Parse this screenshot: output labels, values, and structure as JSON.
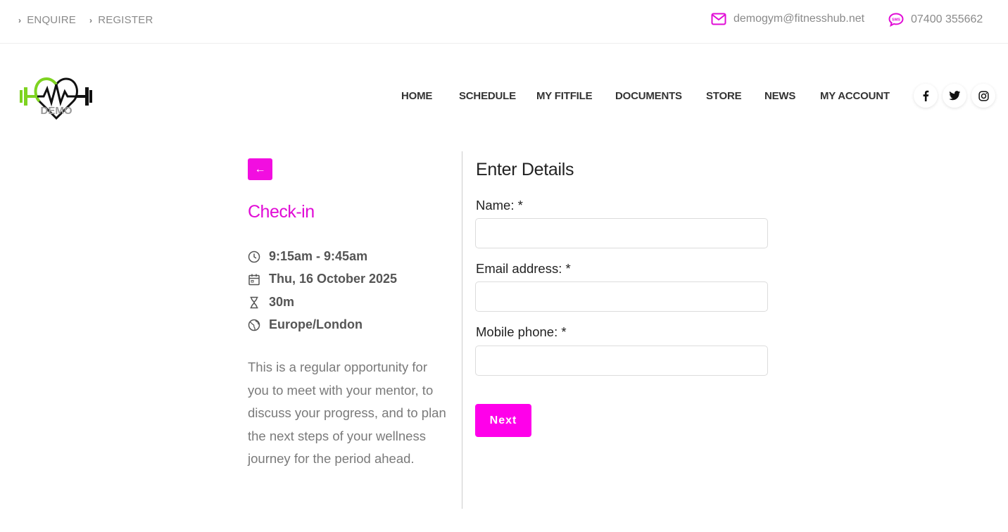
{
  "topbar": {
    "links": [
      {
        "label": "ENQUIRE"
      },
      {
        "label": "REGISTER"
      }
    ],
    "email": "demogym@fitnesshub.net",
    "phone": "07400 355662"
  },
  "header": {
    "logo_text": "DEMO",
    "nav": [
      {
        "label": "HOME"
      },
      {
        "label": "SCHEDULE"
      },
      {
        "label": "MY FITFILE"
      },
      {
        "label": "DOCUMENTS"
      },
      {
        "label": "STORE"
      },
      {
        "label": "NEWS"
      },
      {
        "label": "MY ACCOUNT"
      }
    ],
    "social": [
      {
        "icon": "facebook-icon",
        "glyph": "f"
      },
      {
        "icon": "twitter-icon",
        "glyph": "t"
      },
      {
        "icon": "instagram-icon",
        "glyph": "ig"
      }
    ]
  },
  "event": {
    "back_glyph": "←",
    "title": "Check-in",
    "time": "9:15am - 9:45am",
    "date": "Thu, 16 October 2025",
    "duration": "30m",
    "timezone": "Europe/London",
    "description": "This is a regular opportunity for you to meet with your mentor, to discuss your progress, and to plan the next steps of your wellness journey for the period ahead."
  },
  "form": {
    "title": "Enter Details",
    "name_label": "Name: *",
    "name_value": "",
    "email_label": "Email address: *",
    "email_value": "",
    "phone_label": "Mobile phone: *",
    "phone_value": "",
    "next_label": "Next"
  },
  "colors": {
    "accent": "#ff00ea",
    "title": "#e10bd6",
    "logo_green": "#7ed321"
  }
}
